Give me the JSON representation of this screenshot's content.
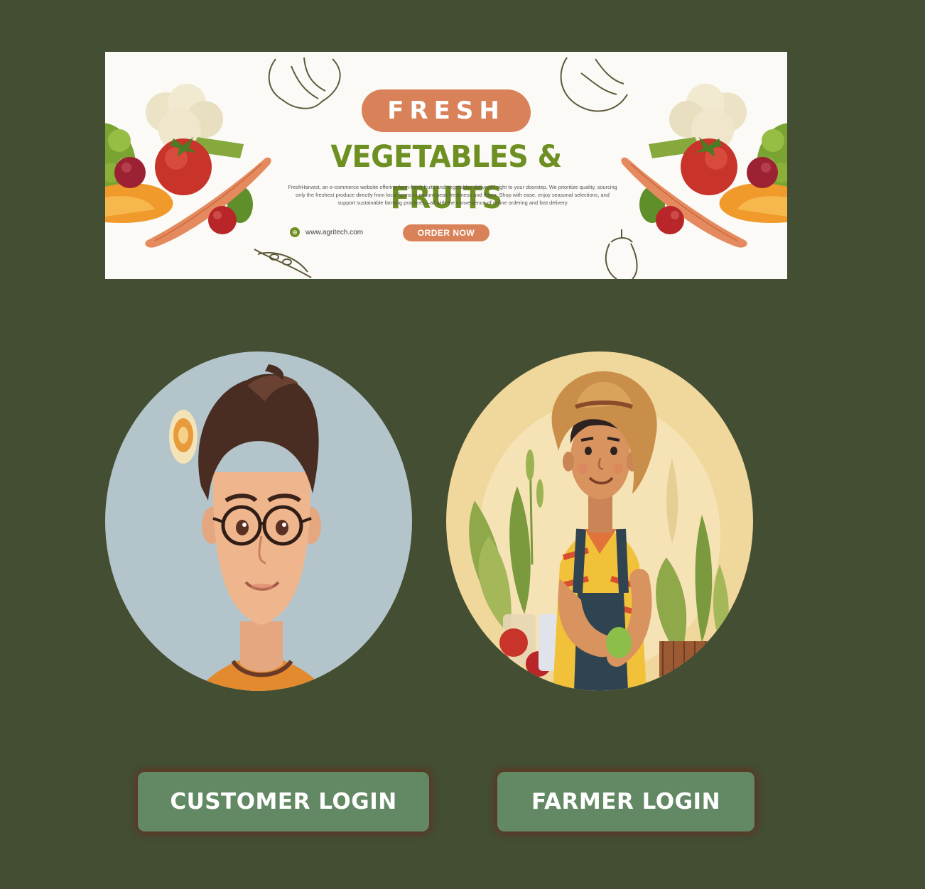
{
  "banner": {
    "tag": "FRESH",
    "headline": "VEGETABLES & FRUITS",
    "blurb": "FreshHarvest, an e-commerce website offering farm-fresh fruits and vegetables delivered right to your doorstep. We prioritize quality, sourcing only the freshest produce directly from local farms to ensure peak freshness and flavor. Shop with ease, enjoy seasonal selections, and support sustainable farming practices—all with the convenience of online ordering and fast delivery",
    "website": "www.agritech.com",
    "order_label": "ORDER NOW",
    "colors": {
      "accent_orange": "#d9825a",
      "headline_green": "#6e8f21"
    }
  },
  "avatars": {
    "customer_icon": "customer-avatar-illustration",
    "farmer_icon": "farmer-avatar-illustration"
  },
  "actions": {
    "customer_login": "CUSTOMER LOGIN",
    "farmer_login": "FARMER LOGIN"
  },
  "theme": {
    "page_background": "#434e32",
    "button_background": "#628963",
    "button_glow": "#6e281e"
  }
}
